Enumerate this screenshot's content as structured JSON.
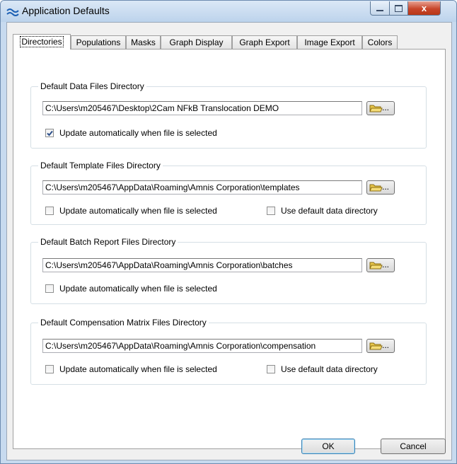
{
  "window": {
    "title": "Application Defaults",
    "controls": {
      "close_glyph": "x"
    }
  },
  "tabs": [
    {
      "label": "Directories",
      "active": true
    },
    {
      "label": "Populations",
      "active": false
    },
    {
      "label": "Masks",
      "active": false
    },
    {
      "label": "Graph Display",
      "active": false
    },
    {
      "label": "Graph Export",
      "active": false
    },
    {
      "label": "Image Export",
      "active": false
    },
    {
      "label": "Colors",
      "active": false
    }
  ],
  "groups": {
    "data": {
      "title": "Default Data Files Directory",
      "path": "C:\\Users\\m205467\\Desktop\\2Cam NFkB Translocation DEMO",
      "update_auto_label": "Update automatically when file is selected",
      "update_auto_checked": true
    },
    "template": {
      "title": "Default Template Files Directory",
      "path": "C:\\Users\\m205467\\AppData\\Roaming\\Amnis Corporation\\templates",
      "update_auto_label": "Update automatically when file is selected",
      "update_auto_checked": false,
      "use_default_label": "Use default data directory",
      "use_default_checked": false
    },
    "batch": {
      "title": "Default Batch Report Files Directory",
      "path": "C:\\Users\\m205467\\AppData\\Roaming\\Amnis Corporation\\batches",
      "update_auto_label": "Update automatically when file is selected",
      "update_auto_checked": false
    },
    "compensation": {
      "title": "Default Compensation Matrix Files Directory",
      "path": "C:\\Users\\m205467\\AppData\\Roaming\\Amnis Corporation\\compensation",
      "update_auto_label": "Update automatically when file is selected",
      "update_auto_checked": false,
      "use_default_label": "Use default data directory",
      "use_default_checked": false
    }
  },
  "buttons": {
    "browse_label": "...",
    "ok": "OK",
    "cancel": "Cancel"
  },
  "colors": {
    "title_bar": "#c7daef",
    "close_button": "#c8462b",
    "checkmark": "#2c4f8a",
    "folder": "#e8c64a"
  }
}
